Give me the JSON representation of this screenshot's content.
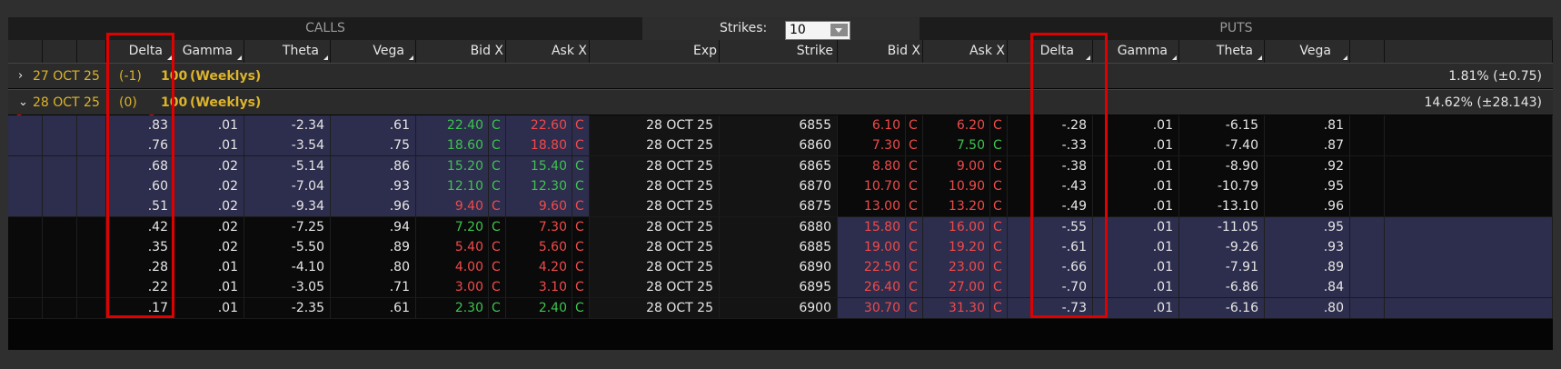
{
  "sections": {
    "calls": "CALLS",
    "puts": "PUTS"
  },
  "strikes": {
    "label": "Strikes:",
    "value": "10"
  },
  "headers": {
    "calls": [
      "Delta",
      "Gamma",
      "Theta",
      "Vega",
      "Bid X",
      "Ask X"
    ],
    "mid": [
      "Exp",
      "Strike"
    ],
    "puts": [
      "Bid X",
      "Ask X",
      "Delta",
      "Gamma",
      "Theta",
      "Vega"
    ]
  },
  "expirations": [
    {
      "chevron": "›",
      "date": "27 OCT 25",
      "paren": "(-1)",
      "mult": "100",
      "tag": "(Weeklys)",
      "pct": "1.81% (±0.75)"
    },
    {
      "chevron": "⌄",
      "date": "28 OCT 25",
      "paren": "(0)",
      "mult": "100",
      "tag": "(Weeklys)",
      "pct": "14.62% (±28.143)"
    }
  ],
  "rows": [
    {
      "c_delta": ".83",
      "c_gamma": ".01",
      "c_theta": "-2.34",
      "c_vega": ".61",
      "c_bid": "22.40",
      "c_bid_color": "green",
      "c_ask": "22.60",
      "c_ask_color": "red",
      "exp": "28 OCT 25",
      "strike": "6855",
      "p_bid": "6.10",
      "p_bid_color": "red",
      "p_ask": "6.20",
      "p_ask_color": "red",
      "p_delta": "-.28",
      "p_gamma": ".01",
      "p_theta": "-6.15",
      "p_vega": ".81",
      "call_itm": true
    },
    {
      "c_delta": ".76",
      "c_gamma": ".01",
      "c_theta": "-3.54",
      "c_vega": ".75",
      "c_bid": "18.60",
      "c_bid_color": "green",
      "c_ask": "18.80",
      "c_ask_color": "red",
      "exp": "28 OCT 25",
      "strike": "6860",
      "p_bid": "7.30",
      "p_bid_color": "red",
      "p_ask": "7.50",
      "p_ask_color": "green",
      "p_delta": "-.33",
      "p_gamma": ".01",
      "p_theta": "-7.40",
      "p_vega": ".87",
      "call_itm": true
    },
    {
      "c_delta": ".68",
      "c_gamma": ".02",
      "c_theta": "-5.14",
      "c_vega": ".86",
      "c_bid": "15.20",
      "c_bid_color": "green",
      "c_ask": "15.40",
      "c_ask_color": "green",
      "exp": "28 OCT 25",
      "strike": "6865",
      "p_bid": "8.80",
      "p_bid_color": "red",
      "p_ask": "9.00",
      "p_ask_color": "red",
      "p_delta": "-.38",
      "p_gamma": ".01",
      "p_theta": "-8.90",
      "p_vega": ".92",
      "call_itm": true
    },
    {
      "c_delta": ".60",
      "c_gamma": ".02",
      "c_theta": "-7.04",
      "c_vega": ".93",
      "c_bid": "12.10",
      "c_bid_color": "green",
      "c_ask": "12.30",
      "c_ask_color": "green",
      "exp": "28 OCT 25",
      "strike": "6870",
      "p_bid": "10.70",
      "p_bid_color": "red",
      "p_ask": "10.90",
      "p_ask_color": "red",
      "p_delta": "-.43",
      "p_gamma": ".01",
      "p_theta": "-10.79",
      "p_vega": ".95",
      "call_itm": true
    },
    {
      "c_delta": ".51",
      "c_gamma": ".02",
      "c_theta": "-9.34",
      "c_vega": ".96",
      "c_bid": "9.40",
      "c_bid_color": "red",
      "c_ask": "9.60",
      "c_ask_color": "red",
      "exp": "28 OCT 25",
      "strike": "6875",
      "p_bid": "13.00",
      "p_bid_color": "red",
      "p_ask": "13.20",
      "p_ask_color": "red",
      "p_delta": "-.49",
      "p_gamma": ".01",
      "p_theta": "-13.10",
      "p_vega": ".96",
      "call_itm": true
    },
    {
      "c_delta": ".42",
      "c_gamma": ".02",
      "c_theta": "-7.25",
      "c_vega": ".94",
      "c_bid": "7.20",
      "c_bid_color": "green",
      "c_ask": "7.30",
      "c_ask_color": "red",
      "exp": "28 OCT 25",
      "strike": "6880",
      "p_bid": "15.80",
      "p_bid_color": "red",
      "p_ask": "16.00",
      "p_ask_color": "red",
      "p_delta": "-.55",
      "p_gamma": ".01",
      "p_theta": "-11.05",
      "p_vega": ".95",
      "call_itm": false
    },
    {
      "c_delta": ".35",
      "c_gamma": ".02",
      "c_theta": "-5.50",
      "c_vega": ".89",
      "c_bid": "5.40",
      "c_bid_color": "red",
      "c_ask": "5.60",
      "c_ask_color": "red",
      "exp": "28 OCT 25",
      "strike": "6885",
      "p_bid": "19.00",
      "p_bid_color": "red",
      "p_ask": "19.20",
      "p_ask_color": "red",
      "p_delta": "-.61",
      "p_gamma": ".01",
      "p_theta": "-9.26",
      "p_vega": ".93",
      "call_itm": false
    },
    {
      "c_delta": ".28",
      "c_gamma": ".01",
      "c_theta": "-4.10",
      "c_vega": ".80",
      "c_bid": "4.00",
      "c_bid_color": "red",
      "c_ask": "4.20",
      "c_ask_color": "red",
      "exp": "28 OCT 25",
      "strike": "6890",
      "p_bid": "22.50",
      "p_bid_color": "red",
      "p_ask": "23.00",
      "p_ask_color": "red",
      "p_delta": "-.66",
      "p_gamma": ".01",
      "p_theta": "-7.91",
      "p_vega": ".89",
      "call_itm": false
    },
    {
      "c_delta": ".22",
      "c_gamma": ".01",
      "c_theta": "-3.05",
      "c_vega": ".71",
      "c_bid": "3.00",
      "c_bid_color": "red",
      "c_ask": "3.10",
      "c_ask_color": "red",
      "exp": "28 OCT 25",
      "strike": "6895",
      "p_bid": "26.40",
      "p_bid_color": "red",
      "p_ask": "27.00",
      "p_ask_color": "red",
      "p_delta": "-.70",
      "p_gamma": ".01",
      "p_theta": "-6.86",
      "p_vega": ".84",
      "call_itm": false
    },
    {
      "c_delta": ".17",
      "c_gamma": ".01",
      "c_theta": "-2.35",
      "c_vega": ".61",
      "c_bid": "2.30",
      "c_bid_color": "green",
      "c_ask": "2.40",
      "c_ask_color": "green",
      "exp": "28 OCT 25",
      "strike": "6900",
      "p_bid": "30.70",
      "p_bid_color": "red",
      "p_ask": "31.30",
      "p_ask_color": "red",
      "p_delta": "-.73",
      "p_gamma": ".01",
      "p_theta": "-6.16",
      "p_vega": ".80",
      "call_itm": false
    }
  ],
  "exchange_flag": "C",
  "colors": {
    "accent": "#ddb42a",
    "bid_red": "#ef4a4a",
    "bid_green": "#3ec24f",
    "itm_bg": "#2d2d4d",
    "annotation": "#e00000"
  }
}
